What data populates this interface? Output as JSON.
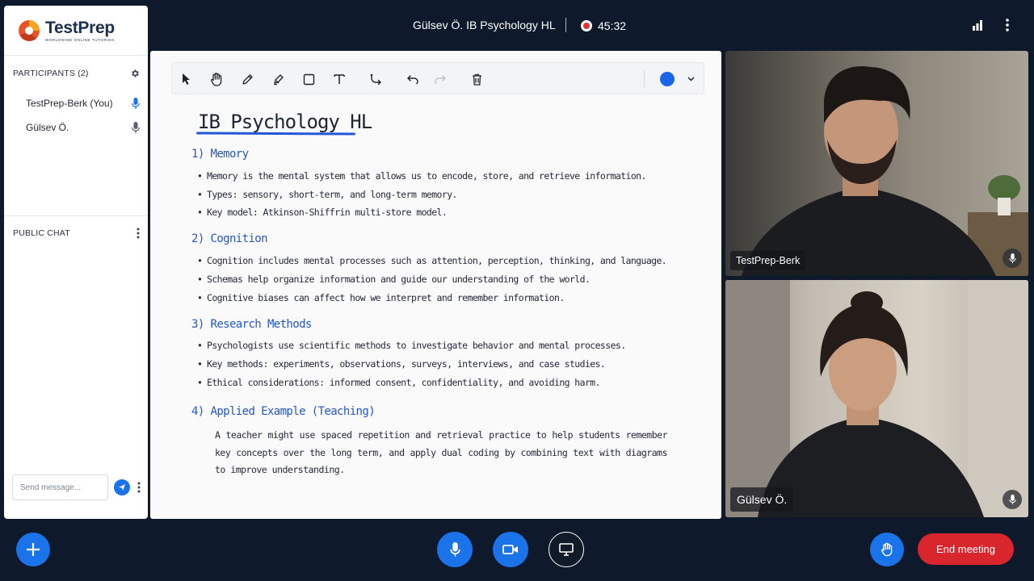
{
  "brand": {
    "name": "TestPrep",
    "tagline": "WORLDWIDE ONLINE TUTORING"
  },
  "header": {
    "title": "Gülsev Ö. IB Psychology HL",
    "timer": "45:32"
  },
  "participants": {
    "heading": "PARTICIPANTS (2)",
    "list": [
      {
        "name": "TestPrep-Berk (You)",
        "mic": "active"
      },
      {
        "name": "Gülsev Ö.",
        "mic": "idle"
      }
    ]
  },
  "chat": {
    "heading": "PUBLIC CHAT",
    "placeholder": "Send message..."
  },
  "whiteboard": {
    "title": "IB Psychology HL",
    "pen_color": "#1a66ea",
    "sections": [
      {
        "heading": "1) Memory",
        "bullets": [
          "Memory is the mental system that allows us to encode, store, and retrieve information.",
          "Types: sensory, short-term, and long-term memory.",
          "Key model: Atkinson-Shiffrin multi-store model."
        ]
      },
      {
        "heading": "2) Cognition",
        "bullets": [
          "Cognition includes mental processes such as attention, perception, thinking, and language.",
          "Schemas help organize information and guide our understanding of the world.",
          "Cognitive biases can affect how we interpret and remember information."
        ]
      },
      {
        "heading": "3) Research Methods",
        "bullets": [
          "Psychologists use scientific methods to investigate behavior and mental processes.",
          "Key methods: experiments, observations, surveys, interviews, and case studies.",
          "Ethical considerations: informed consent, confidentiality, and avoiding harm."
        ]
      },
      {
        "heading": "4) Applied Example (Teaching)",
        "paragraph": "A teacher might use spaced repetition and retrieval practice to help students remember key concepts over the long term, and apply dual coding by combining text with diagrams to improve understanding."
      }
    ]
  },
  "videos": [
    {
      "name": "TestPrep-Berk"
    },
    {
      "name": "Gülsev Ö."
    }
  ],
  "controls": {
    "end_label": "End meeting"
  },
  "colors": {
    "accent": "#1a73e8",
    "end": "#d8262c",
    "background": "#0e1a2c",
    "recording": "#e5312f"
  }
}
